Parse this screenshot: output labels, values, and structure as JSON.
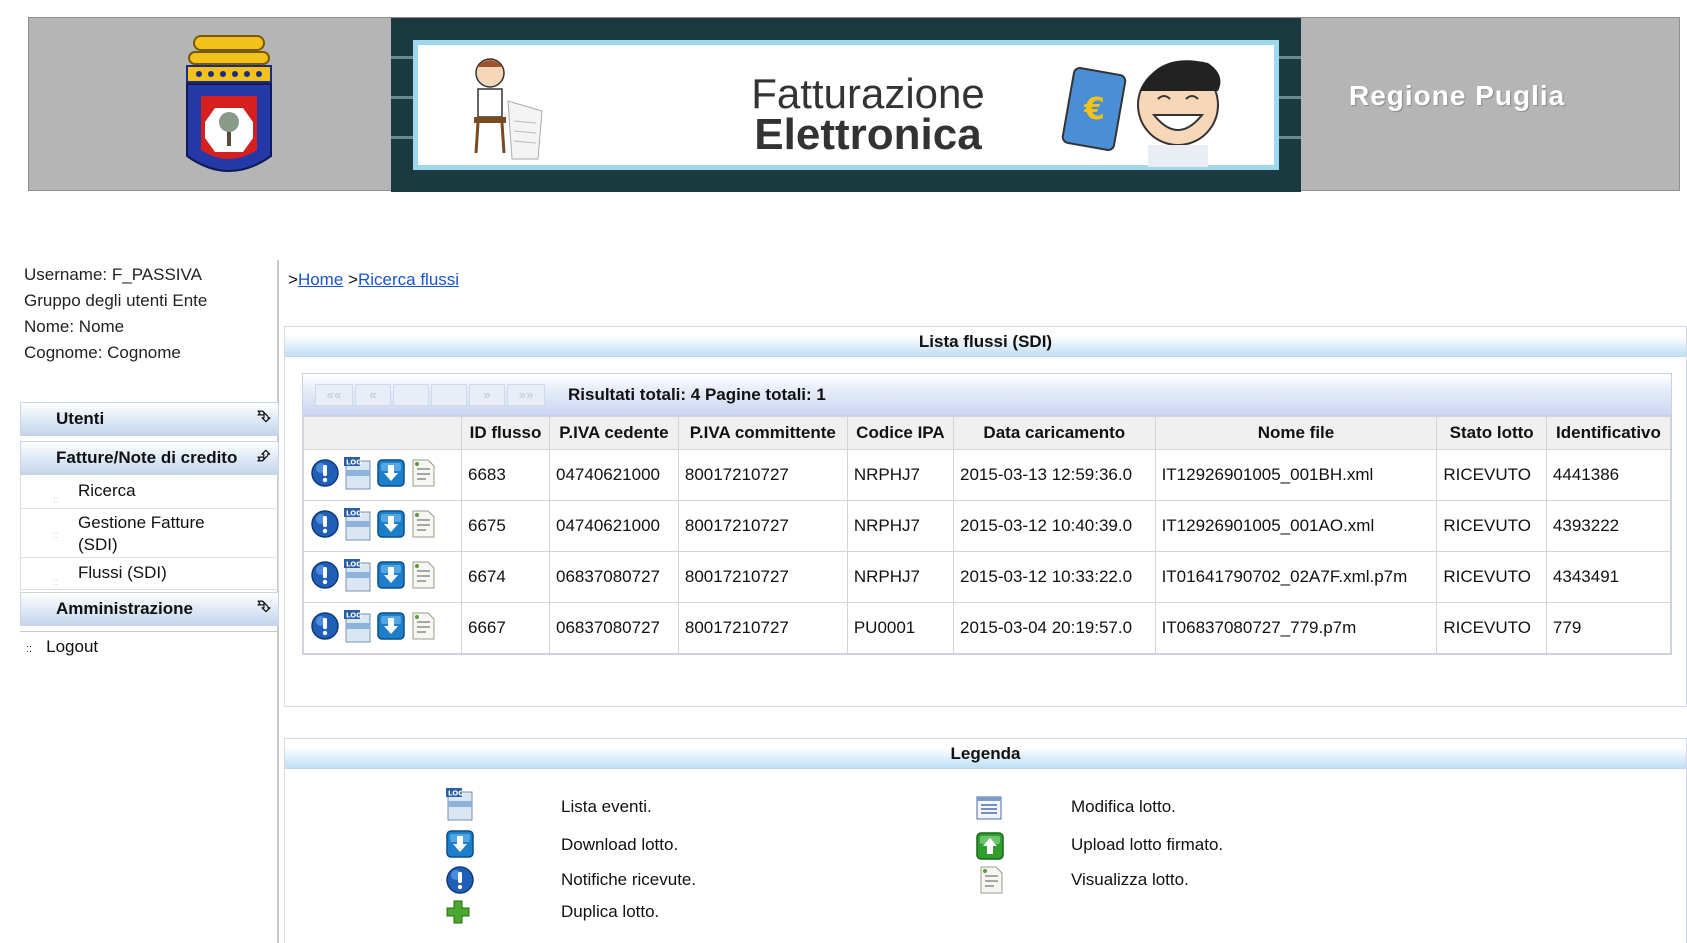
{
  "header": {
    "title_line1": "Fatturazione",
    "title_line2": "Elettronica",
    "region": "Regione Puglia"
  },
  "user": {
    "username": "Username: F_PASSIVA",
    "group": "Gruppo degli utenti Ente",
    "nome": "Nome: Nome",
    "cognome": "Cognome: Cognome"
  },
  "menu": {
    "utenti": "Utenti",
    "fatture": "Fatture/Note di credito",
    "fatture_items": [
      "Ricerca",
      "Gestione Fatture (SDI)",
      "Flussi (SDI)"
    ],
    "amministrazione": "Amministrazione",
    "logout": "Logout"
  },
  "breadcrumb": {
    "sep": ">",
    "home": "Home",
    "current": "Ricerca flussi"
  },
  "list": {
    "title": "Lista flussi (SDI)",
    "pager": {
      "first": "««",
      "prev": "«",
      "next": "»",
      "last": "»»",
      "summary": "Risultati totali: 4  Pagine totali: 1"
    },
    "columns": [
      "ID flusso",
      "P.IVA cedente",
      "P.IVA committente",
      "Codice IPA",
      "Data caricamento",
      "Nome file",
      "Stato lotto",
      "Identificativo"
    ],
    "rows": [
      [
        "6683",
        "04740621000",
        "80017210727",
        "NRPHJ7",
        "2015-03-13 12:59:36.0",
        "IT12926901005_001BH.xml",
        "RICEVUTO",
        "4441386"
      ],
      [
        "6675",
        "04740621000",
        "80017210727",
        "NRPHJ7",
        "2015-03-12 10:40:39.0",
        "IT12926901005_001AO.xml",
        "RICEVUTO",
        "4393222"
      ],
      [
        "6674",
        "06837080727",
        "80017210727",
        "NRPHJ7",
        "2015-03-12 10:33:22.0",
        "IT01641790702_02A7F.xml.p7m",
        "RICEVUTO",
        "4343491"
      ],
      [
        "6667",
        "06837080727",
        "80017210727",
        "PU0001",
        "2015-03-04 20:19:57.0",
        "IT06837080727_779.p7m",
        "RICEVUTO",
        "779"
      ]
    ]
  },
  "legend": {
    "title": "Legenda",
    "lista_eventi": "Lista eventi.",
    "download": "Download lotto.",
    "notifiche": "Notifiche ricevute.",
    "duplica": "Duplica lotto.",
    "modifica": "Modifica lotto.",
    "upload": "Upload lotto firmato.",
    "visualizza": "Visualizza lotto."
  },
  "colors": {
    "banner_bg": "#b5b5b5",
    "band_dark": "#1a3a3f",
    "band_border": "#9fd8ee",
    "link": "#1a55cc",
    "icon_blue": "#1f78c4",
    "icon_green": "#3aa53a"
  },
  "icons": [
    "crest-icon",
    "notification-icon",
    "log-icon",
    "download-icon",
    "view-icon",
    "edit-icon",
    "upload-icon",
    "duplicate-icon",
    "chevron-down-icon",
    "chevron-up-icon"
  ]
}
